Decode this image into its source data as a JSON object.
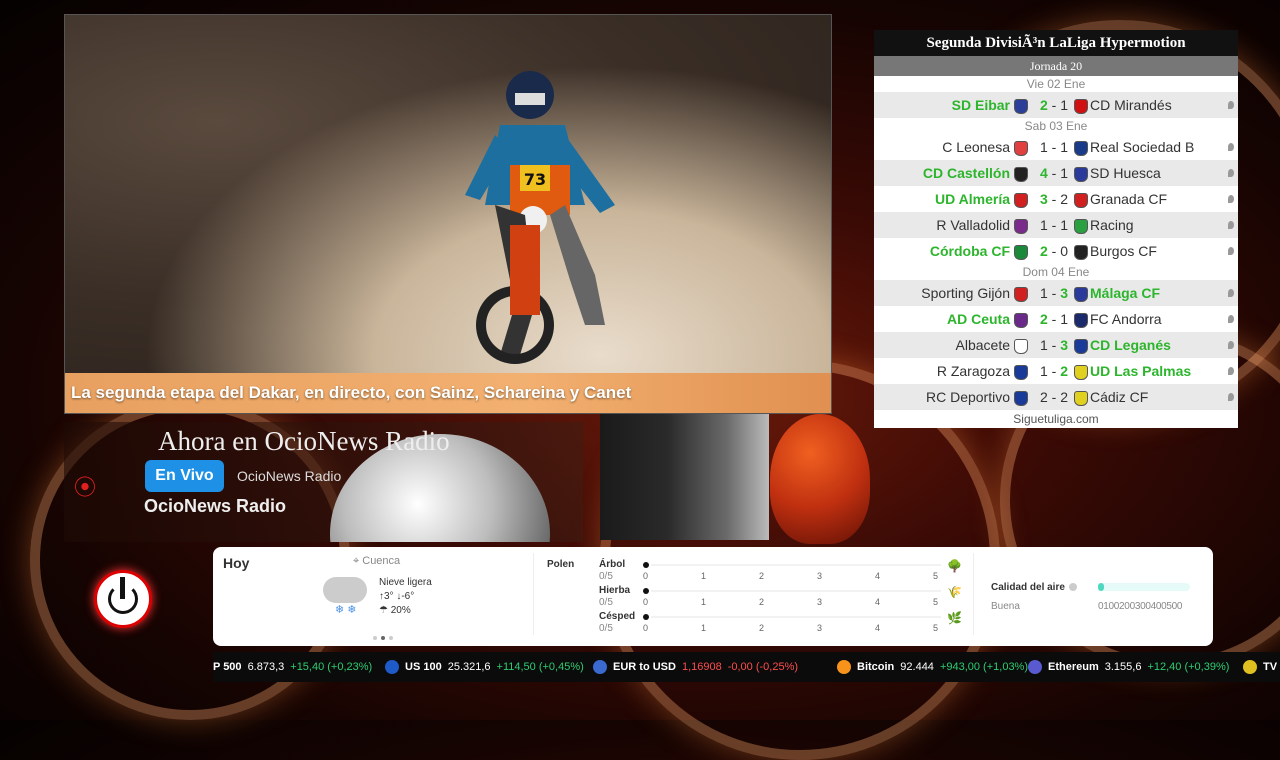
{
  "news": {
    "headline": "La segunda etapa del Dakar, en directo, con Sainz, Schareina y Canet",
    "bike_number": "73"
  },
  "league": {
    "title": "Segunda DivisiÃ³n LaLiga Hypermotion",
    "round": "Jornada 20",
    "footer": "Siguetuliga.com",
    "days": [
      {
        "label": "Vie 02 Ene",
        "matches": [
          {
            "home": "SD Eibar",
            "score": "2 - 1",
            "away": "CD Mirandés",
            "winner": "home",
            "home_color": "#2b3f9a",
            "away_color": "#d01010"
          }
        ]
      },
      {
        "label": "Sab 03 Ene",
        "matches": [
          {
            "home": "C Leonesa",
            "score": "1 - 1",
            "away": "Real Sociedad B",
            "winner": "none",
            "home_color": "#e04040",
            "away_color": "#1a3a8a"
          },
          {
            "home": "CD Castellón",
            "score": "4 - 1",
            "away": "SD Huesca",
            "winner": "home",
            "home_color": "#222222",
            "away_color": "#2a3a9a"
          },
          {
            "home": "UD Almería",
            "score": "3 - 2",
            "away": "Granada CF",
            "winner": "home",
            "home_color": "#d02020",
            "away_color": "#d02020"
          },
          {
            "home": "R Valladolid",
            "score": "1 - 1",
            "away": "Racing",
            "winner": "none",
            "home_color": "#7a2a8a",
            "away_color": "#2aa040"
          },
          {
            "home": "Córdoba CF",
            "score": "2 - 0",
            "away": "Burgos CF",
            "winner": "home",
            "home_color": "#1a8a3a",
            "away_color": "#222222"
          }
        ]
      },
      {
        "label": "Dom 04 Ene",
        "matches": [
          {
            "home": "Sporting Gijón",
            "score": "1 - 3",
            "away": "Málaga CF",
            "winner": "away",
            "home_color": "#d02020",
            "away_color": "#2a3a9a"
          },
          {
            "home": "AD Ceuta",
            "score": "2 - 1",
            "away": "FC Andorra",
            "winner": "home",
            "home_color": "#6a2a8a",
            "away_color": "#1a2a6a"
          },
          {
            "home": "Albacete",
            "score": "1 - 3",
            "away": "CD Leganés",
            "winner": "away",
            "home_color": "#ffffff",
            "away_color": "#1a3a9a"
          },
          {
            "home": "R Zaragoza",
            "score": "1 - 2",
            "away": "UD Las Palmas",
            "winner": "away",
            "home_color": "#1a3a9a",
            "away_color": "#e0d020"
          },
          {
            "home": "RC Deportivo",
            "score": "2 - 2",
            "away": "Cádiz CF",
            "winner": "none",
            "home_color": "#1a3a9a",
            "away_color": "#e0d020"
          }
        ]
      }
    ]
  },
  "radio": {
    "heading": "Ahora en OcioNews Radio",
    "live_label": "En Vivo",
    "station_small": "OcioNews Radio",
    "station_name": "OcioNews Radio"
  },
  "weather": {
    "today": "Hoy",
    "location": "Cuenca",
    "condition": "Nieve ligera",
    "temp_high": "3°",
    "temp_low": "-6°",
    "precip": "20%",
    "polen_label": "Polen",
    "polen": [
      {
        "name": "Árbol",
        "score": "0/5",
        "value": 0
      },
      {
        "name": "Hierba",
        "score": "0/5",
        "value": 0
      },
      {
        "name": "Césped",
        "score": "0/5",
        "value": 0
      }
    ],
    "scale": [
      "0",
      "1",
      "2",
      "3",
      "4",
      "5"
    ],
    "air_label": "Calidad del aire",
    "air_state": "Buena",
    "air_scale": "0100200300400500",
    "air_fraction": 0.06
  },
  "ticker": [
    {
      "name": "P 500",
      "price": "6.873,3",
      "change": "+15,40 (+0,23%)",
      "dir": "up",
      "icon_color": ""
    },
    {
      "name": "US 100",
      "price": "25.321,6",
      "change": "+114,50 (+0,45%)",
      "dir": "up",
      "icon_color": "#1e5ac8"
    },
    {
      "name": "EUR to USD",
      "price": "1,16908",
      "change": "-0,00 (-0,25%)",
      "dir": "dn",
      "icon_color": "#3a6ad0"
    },
    {
      "name": "Bitcoin",
      "price": "92.444",
      "change": "+943,00 (+1,03%)",
      "dir": "up",
      "icon_color": "#f7931a"
    },
    {
      "name": "Ethereum",
      "price": "3.155,6",
      "change": "+12,40 (+0,39%)",
      "dir": "up",
      "icon_color": "#5a5ad0"
    }
  ],
  "ticker_tail": "TV"
}
